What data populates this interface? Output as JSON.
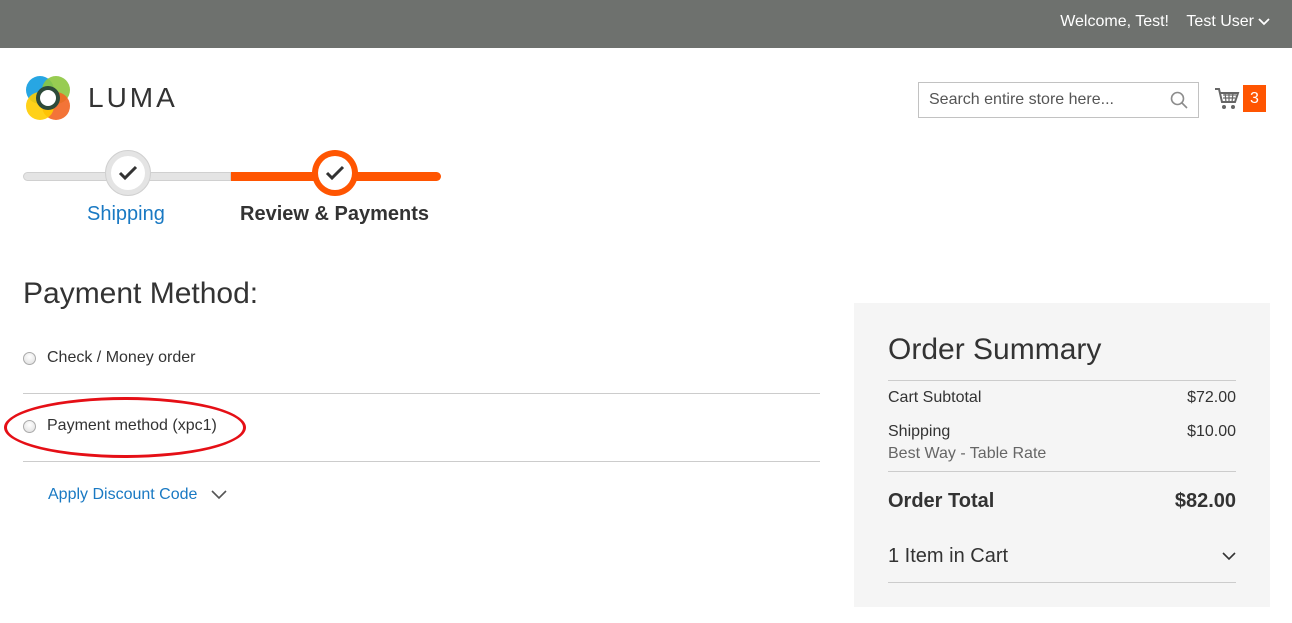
{
  "header": {
    "welcome_text": "Welcome, Test!",
    "user_label": "Test User",
    "user_icon": "chevron-down-icon"
  },
  "logo": {
    "text": "LUMA"
  },
  "search": {
    "placeholder": "Search entire store here...",
    "value": ""
  },
  "cart": {
    "count": "3",
    "icon": "cart-icon"
  },
  "progress": {
    "steps": [
      {
        "label": "Shipping",
        "state": "complete"
      },
      {
        "label": "Review & Payments",
        "state": "active"
      }
    ]
  },
  "payment": {
    "title": "Payment Method:",
    "options": [
      {
        "label": "Check / Money order",
        "selected": false
      },
      {
        "label": "Payment method (xpc1)",
        "selected": false
      }
    ],
    "discount_label": "Apply Discount Code"
  },
  "summary": {
    "title": "Order Summary",
    "cart_subtotal_label": "Cart Subtotal",
    "cart_subtotal_value": "$72.00",
    "shipping_label": "Shipping",
    "shipping_value": "$10.00",
    "shipping_method": "Best Way - Table Rate",
    "order_total_label": "Order Total",
    "order_total_value": "$82.00",
    "items_label": "1 Item in Cart"
  },
  "colors": {
    "topbar": "#6e716e",
    "accent": "#ff5501",
    "link": "#1979c3",
    "annotation": "#e50f16",
    "summary_bg": "#f5f5f5"
  }
}
